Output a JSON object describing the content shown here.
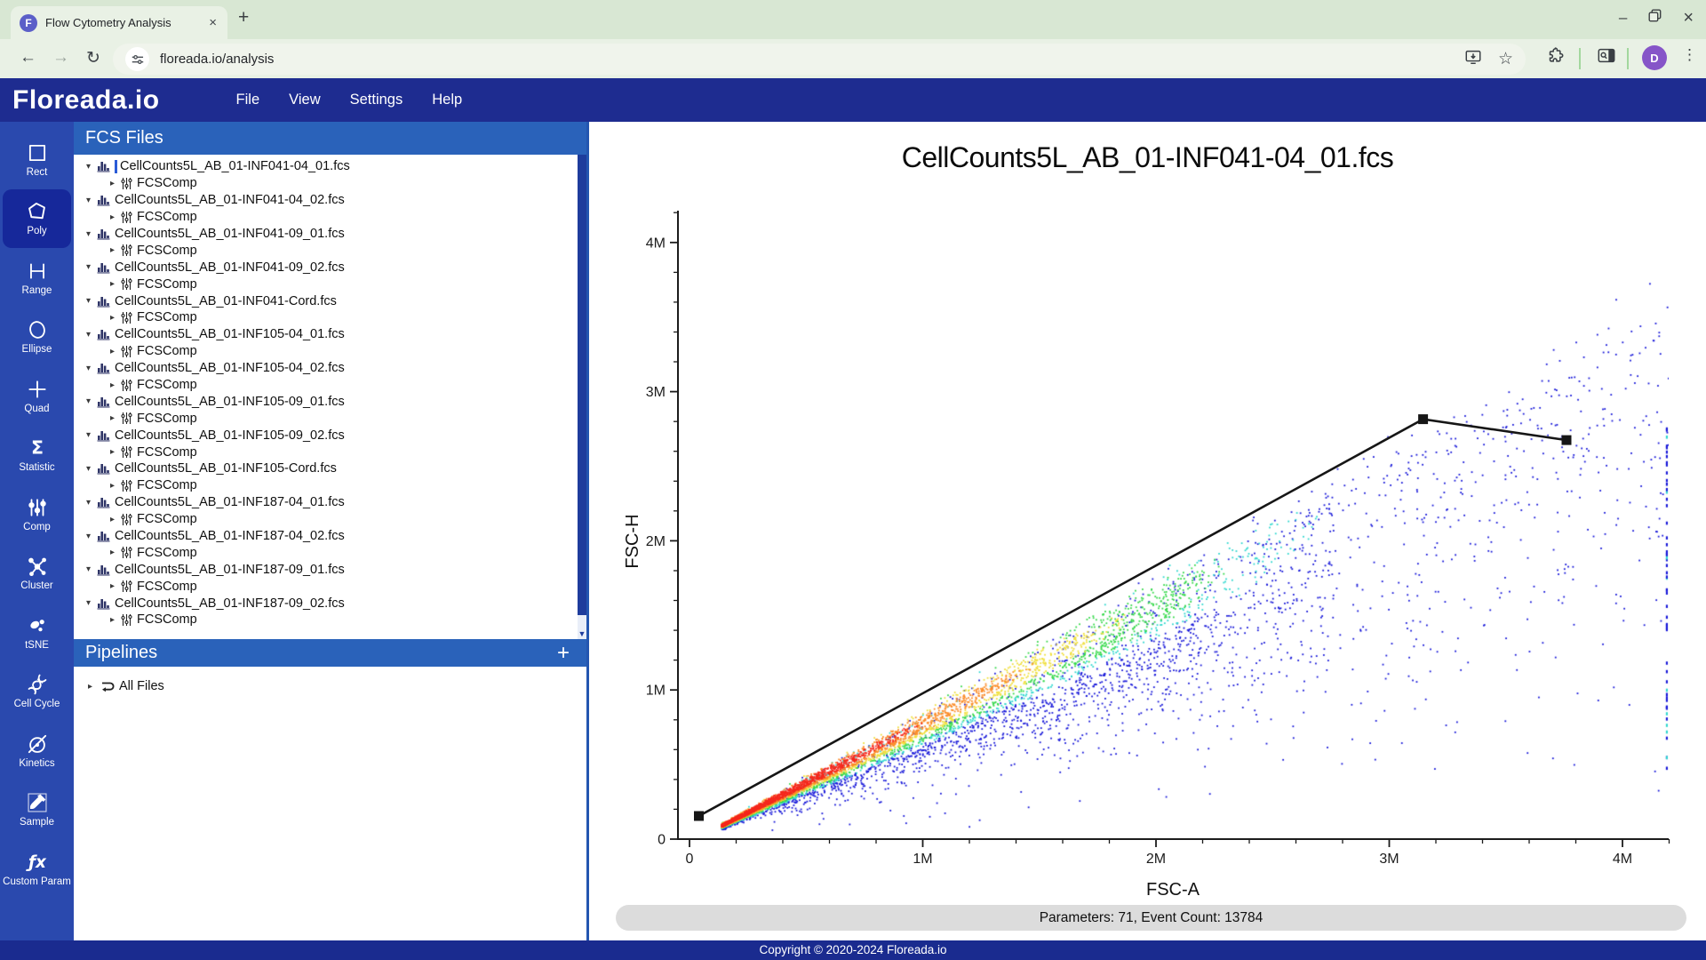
{
  "browser": {
    "tab_title": "Flow Cytometry Analysis",
    "favicon_letter": "F",
    "new_tab_button": "+",
    "url": "floreada.io/analysis",
    "profile_initial": "D"
  },
  "app": {
    "logo": "Floreada.io",
    "menus": [
      "File",
      "View",
      "Settings",
      "Help"
    ]
  },
  "sidebar": {
    "tools": [
      {
        "id": "rect",
        "label": "Rect",
        "selected": false
      },
      {
        "id": "poly",
        "label": "Poly",
        "selected": true
      },
      {
        "id": "range",
        "label": "Range",
        "selected": false
      },
      {
        "id": "ellipse",
        "label": "Ellipse",
        "selected": false
      },
      {
        "id": "quad",
        "label": "Quad",
        "selected": false
      },
      {
        "id": "statistic",
        "label": "Statistic",
        "selected": false
      },
      {
        "id": "comp",
        "label": "Comp",
        "selected": false
      },
      {
        "id": "cluster",
        "label": "Cluster",
        "selected": false
      },
      {
        "id": "tsne",
        "label": "tSNE",
        "selected": false
      },
      {
        "id": "cellcycle",
        "label": "Cell Cycle",
        "selected": false
      },
      {
        "id": "kinetics",
        "label": "Kinetics",
        "selected": false
      },
      {
        "id": "sample",
        "label": "Sample",
        "selected": false
      },
      {
        "id": "customparam",
        "label": "Custom Param",
        "selected": false
      }
    ]
  },
  "fcs_panel": {
    "title": "FCS Files",
    "child_label": "FCSComp",
    "selected_index": 0,
    "files": [
      "CellCounts5L_AB_01-INF041-04_01.fcs",
      "CellCounts5L_AB_01-INF041-04_02.fcs",
      "CellCounts5L_AB_01-INF041-09_01.fcs",
      "CellCounts5L_AB_01-INF041-09_02.fcs",
      "CellCounts5L_AB_01-INF041-Cord.fcs",
      "CellCounts5L_AB_01-INF105-04_01.fcs",
      "CellCounts5L_AB_01-INF105-04_02.fcs",
      "CellCounts5L_AB_01-INF105-09_01.fcs",
      "CellCounts5L_AB_01-INF105-09_02.fcs",
      "CellCounts5L_AB_01-INF105-Cord.fcs",
      "CellCounts5L_AB_01-INF187-04_01.fcs",
      "CellCounts5L_AB_01-INF187-04_02.fcs",
      "CellCounts5L_AB_01-INF187-09_01.fcs",
      "CellCounts5L_AB_01-INF187-09_02.fcs"
    ]
  },
  "pipelines": {
    "title": "Pipelines",
    "add_button": "+",
    "items": [
      "All Files"
    ]
  },
  "status_bar": {
    "text": "Parameters: 71, Event Count: 13784"
  },
  "footer": {
    "copyright": "Copyright © 2020-2024 Floreada.io"
  },
  "chart_data": {
    "type": "scatter",
    "title": "CellCounts5L_AB_01-INF041-04_01.fcs",
    "xlabel": "FSC-A",
    "ylabel": "FSC-H",
    "xlim": [
      0,
      4200000
    ],
    "ylim": [
      0,
      4200000
    ],
    "grid": false,
    "x_ticks": [
      {
        "value": 0,
        "label": "0"
      },
      {
        "value": 1000000,
        "label": "1M"
      },
      {
        "value": 2000000,
        "label": "2M"
      },
      {
        "value": 3000000,
        "label": "3M"
      },
      {
        "value": 4000000,
        "label": "4M"
      }
    ],
    "y_ticks": [
      {
        "value": 0,
        "label": "0"
      },
      {
        "value": 1000000,
        "label": "1M"
      },
      {
        "value": 2000000,
        "label": "2M"
      },
      {
        "value": 3000000,
        "label": "3M"
      },
      {
        "value": 4000000,
        "label": "4M"
      }
    ],
    "minor_tick_interval": 200000,
    "parameters": 71,
    "event_count": 13784,
    "gate_polygon": {
      "tool": "Poly",
      "in_progress": true,
      "color": "#161616",
      "vertices": [
        [
          40000,
          155000
        ],
        [
          3145000,
          2815000
        ],
        [
          3760000,
          2675000
        ]
      ]
    },
    "density_scatter": {
      "description": "Density-colored FSC-A vs FSC-H event cloud: tight red core band near origin along slope ~0.8, fading through orange/yellow/green/cyan to a sparse blue cloud extending to 4.2M",
      "n_points": 7200,
      "seed": 42,
      "ridge_slope": 0.8,
      "ridge_intercept": -20000,
      "colormap": [
        {
          "min_t": 0.7,
          "color": "#f5281c"
        },
        {
          "min_t": 0.55,
          "color": "#fb8c28"
        },
        {
          "min_t": 0.42,
          "color": "#efdf3a"
        },
        {
          "min_t": 0.27,
          "color": "#35d94a"
        },
        {
          "min_t": 0.16,
          "color": "#2fd8cf"
        },
        {
          "min_t": 0.0,
          "color": "#1717d9"
        }
      ]
    },
    "clipped_edge_column": {
      "x": 4190000,
      "count": 55,
      "y_range": [
        450000,
        2750000
      ]
    }
  },
  "colors": {
    "navbar": "#1e2c90",
    "sidebar": "#2a49ae",
    "sidebar_selected": "#16289a",
    "panel_header": "#2a62ba",
    "footer": "#1a2b8f",
    "chrome_tabstrip": "#d8e7d3",
    "chrome_toolbar": "#e9f1e5",
    "address_pill": "#f0f4ec",
    "favicon": "#5b5fc8",
    "avatar": "#8655c8",
    "status_pill": "#dcdcdc"
  }
}
